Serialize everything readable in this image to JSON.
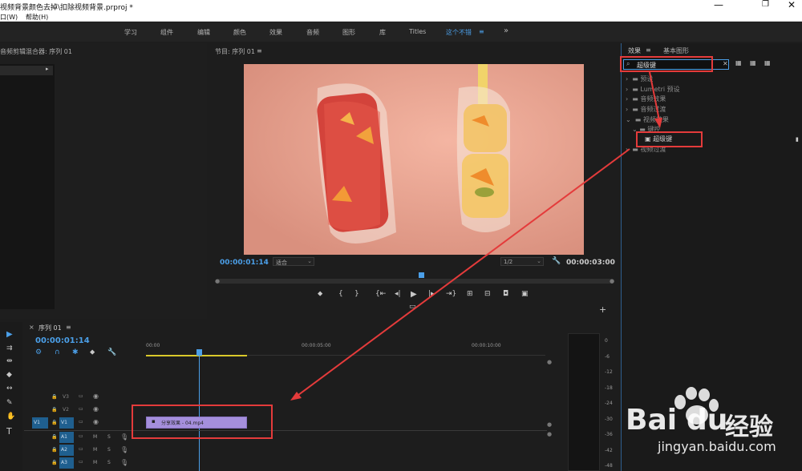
{
  "window": {
    "title": "视频背景颜色去掉\\扣除视频背景.prproj *",
    "minimize": "—",
    "maximize": "❐",
    "close": "✕"
  },
  "menu": {
    "items": [
      "口(W)",
      "帮助(H)"
    ]
  },
  "workspaces": {
    "tabs": [
      "学习",
      "组件",
      "编辑",
      "颜色",
      "效果",
      "音频",
      "图形",
      "库",
      "Titles",
      "这个不错"
    ],
    "active": "这个不错",
    "menu": "≡",
    "more": "»"
  },
  "source_panel": {
    "title": "音频剪辑混合器: 序列 01"
  },
  "program": {
    "title": "节目: 序列 01",
    "menu": "≡",
    "timecode": "00:00:01:14",
    "fit": "适合",
    "resolution": "1/2",
    "duration": "00:00:03:00"
  },
  "effects": {
    "tab_effects": "效果",
    "tab_menu": "≡",
    "tab_graphics": "基本图形",
    "search_value": "超级键",
    "clear": "✕",
    "tree": [
      {
        "label": "预设",
        "depth": 0
      },
      {
        "label": "Lumetri 预设",
        "depth": 0
      },
      {
        "label": "音频效果",
        "depth": 0
      },
      {
        "label": "音频过渡",
        "depth": 0
      },
      {
        "label": "视频效果",
        "depth": 0
      },
      {
        "label": "键控",
        "depth": 1
      },
      {
        "label": "超级键",
        "depth": 2
      },
      {
        "label": "视频过渡",
        "depth": 0
      }
    ]
  },
  "timeline": {
    "title": "序列 01",
    "menu": "≡",
    "timecode": "00:00:01:14",
    "ruler": [
      "00:00",
      "00:00:05:00",
      "00:00:10:00"
    ],
    "tracks": [
      {
        "name": "V3",
        "kind": "video"
      },
      {
        "name": "V2",
        "kind": "video"
      },
      {
        "name": "V1",
        "kind": "video",
        "source": "V1"
      },
      {
        "name": "A1",
        "kind": "audio"
      },
      {
        "name": "A2",
        "kind": "audio"
      },
      {
        "name": "A3",
        "kind": "audio"
      }
    ],
    "clip": {
      "label": "分享效果 - 04.mp4",
      "color": "#a58fdc"
    }
  },
  "meter": {
    "scale": [
      "0",
      "-6",
      "-12",
      "-18",
      "-24",
      "-30",
      "-36",
      "-42",
      "-48"
    ]
  },
  "watermark": {
    "site": "jingyan.baidu.com",
    "brand": "Bai",
    "brand2": "du",
    "brand3": "经验"
  },
  "colors": {
    "accent": "#4b9fe8",
    "highlight": "#e43b3b",
    "clip": "#a58fdc",
    "bg": "#1d1d1d"
  },
  "icons": [
    "search-icon",
    "folder-icon",
    "effect-icon",
    "play-icon",
    "wrench-icon",
    "eye-icon",
    "lock-icon",
    "mic-icon",
    "selection-tool-icon",
    "type-tool-icon",
    "hand-tool-icon",
    "pen-tool-icon",
    "razor-tool-icon"
  ]
}
